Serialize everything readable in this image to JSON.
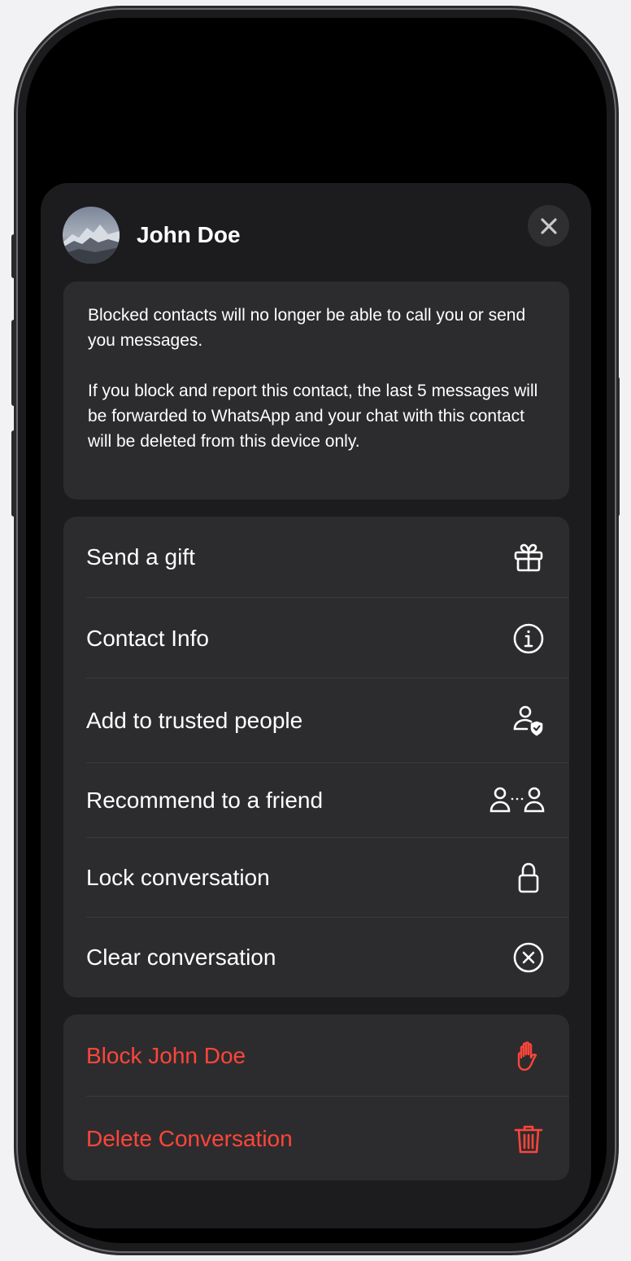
{
  "contact": {
    "name": "John Doe"
  },
  "info": {
    "paragraph1": "Blocked contacts will no longer be able to call you or send you messages.",
    "paragraph2": "If you block and report this contact, the last 5 messages will be forwarded to WhatsApp and your chat with this contact will be deleted from this device only."
  },
  "menu": {
    "items": [
      {
        "label": "Send a gift",
        "icon": "gift-icon"
      },
      {
        "label": "Contact Info",
        "icon": "info-circle-icon"
      },
      {
        "label": "Add to trusted people",
        "icon": "person-shield-icon"
      },
      {
        "label": "Recommend to a friend",
        "icon": "share-contact-icon"
      },
      {
        "label": "Lock conversation",
        "icon": "lock-icon"
      },
      {
        "label": "Clear conversation",
        "icon": "x-circle-icon"
      }
    ]
  },
  "danger": {
    "items": [
      {
        "label": "Block John Doe",
        "icon": "hand-raised-icon"
      },
      {
        "label": "Delete Conversation",
        "icon": "trash-icon"
      }
    ]
  },
  "colors": {
    "background": "#1c1c1e",
    "card": "#2c2c2e",
    "text": "#ffffff",
    "destructive": "#ff453a"
  }
}
